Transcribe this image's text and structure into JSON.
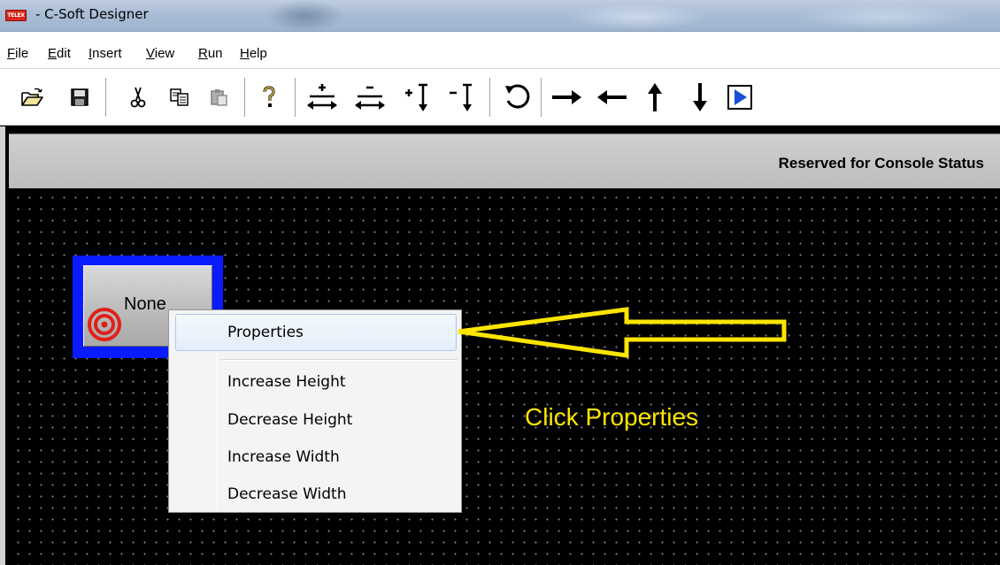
{
  "window": {
    "app_icon_text": "TELEX",
    "title": "- C-Soft Designer"
  },
  "menu": {
    "items": [
      {
        "label": "File",
        "mnemonic": "F",
        "rest": "ile"
      },
      {
        "label": "Edit",
        "mnemonic": "E",
        "rest": "dit"
      },
      {
        "label": "Insert",
        "mnemonic": "I",
        "rest": "nsert"
      },
      {
        "label": "View",
        "mnemonic": "V",
        "rest": "iew"
      },
      {
        "label": "Run",
        "mnemonic": "R",
        "rest": "un"
      },
      {
        "label": "Help",
        "mnemonic": "H",
        "rest": "elp"
      }
    ]
  },
  "toolbar": {
    "buttons": [
      "open-folder",
      "save",
      "cut",
      "copy",
      "paste",
      "help",
      "increase-width",
      "decrease-width",
      "increase-height",
      "decrease-height",
      "rotate",
      "move-right",
      "move-left",
      "move-up",
      "move-down",
      "run"
    ]
  },
  "workspace": {
    "status_text": "Reserved for Console Status",
    "canvas_button_label": "None"
  },
  "context_menu": {
    "items": [
      "Properties",
      "Increase Height",
      "Decrease Height",
      "Increase Width",
      "Decrease Width"
    ]
  },
  "annotation": {
    "text": "Click Properties",
    "color": "#ffe500"
  },
  "colors": {
    "selection_outline": "#0a1cff",
    "target_icon": "#e0201b"
  }
}
